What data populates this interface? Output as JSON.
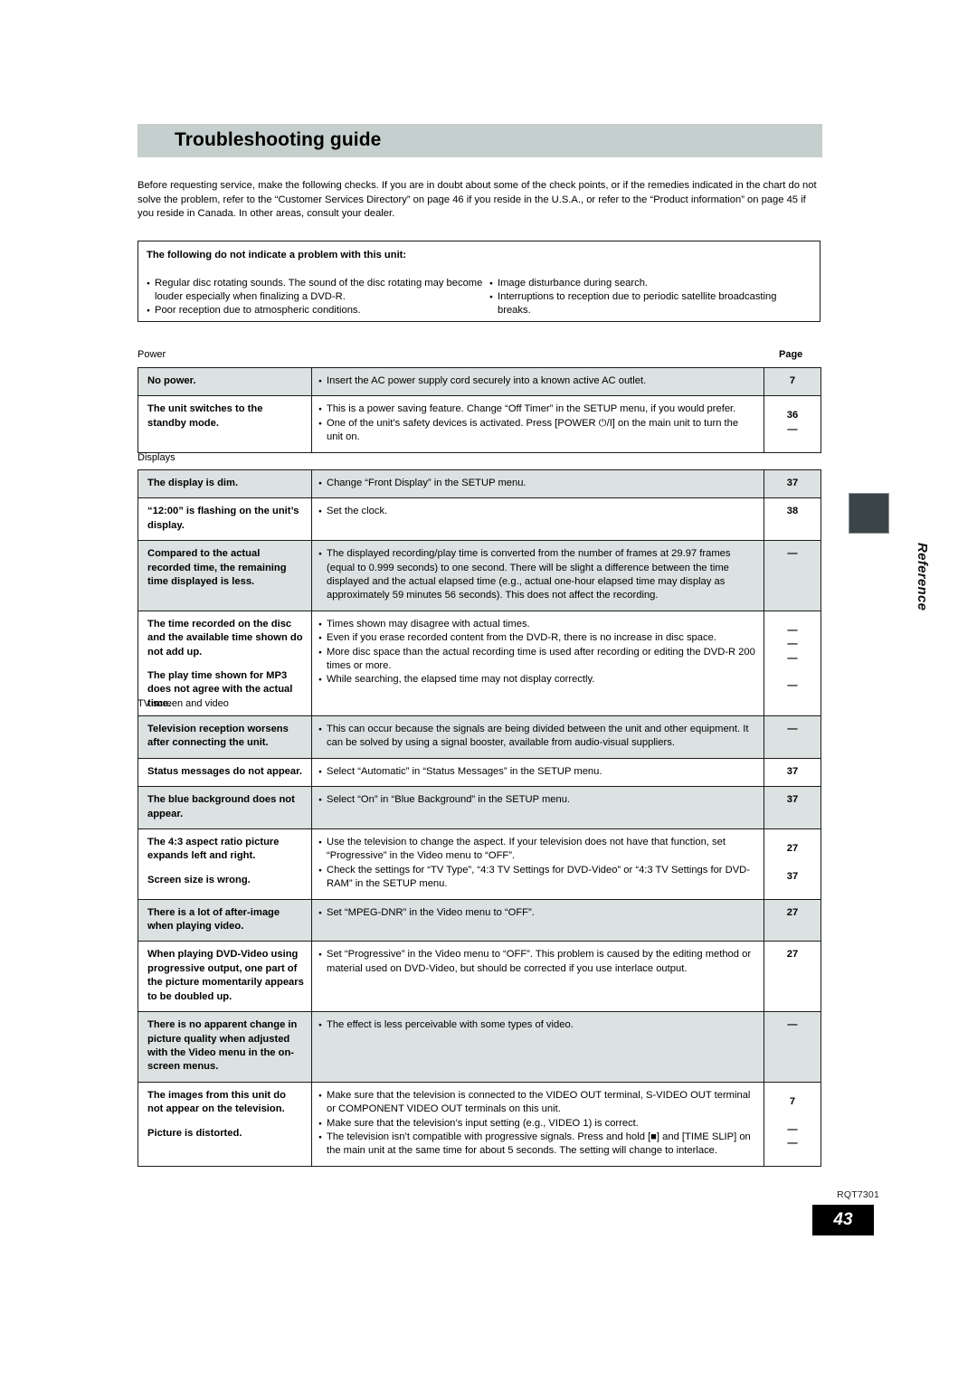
{
  "document": {
    "title": "Troubleshooting guide",
    "intro": "Before requesting service, make the following checks. If you are in doubt about some of the check points, or if the remedies indicated in the chart do not solve the problem, refer to the “Customer Services Directory” on page 46 if you reside in the U.S.A., or refer to the “Product information” on page 45 if you reside in Canada. In other areas, consult your dealer.",
    "side_tab": "Reference",
    "footer_code": "RQT7301",
    "page_number": "43"
  },
  "notebox": {
    "heading": "The following do not indicate a problem with this unit:",
    "left_items": [
      "Regular disc rotating sounds. The sound of the disc rotating may become louder especially when finalizing a DVD-R.",
      "Poor reception due to atmospheric conditions."
    ],
    "right_items": [
      "Image disturbance during search.",
      "Interruptions to reception due to periodic satellite broadcasting breaks."
    ]
  },
  "page_column_label": "Page",
  "sections": [
    {
      "label": "Power",
      "rows": [
        {
          "symptom": [
            "No power."
          ],
          "remedies": [
            "Insert the AC power supply cord securely into a known active AC outlet."
          ],
          "pages": [
            "7"
          ]
        },
        {
          "symptom": [
            "The unit switches to the standby mode."
          ],
          "remedies": [
            "This is a power saving feature. Change “Off Timer” in the SETUP menu, if you would prefer.",
            "One of the unit’s safety devices is activated. Press [POWER ⏻/I] on the main unit to turn the unit on."
          ],
          "pages": [
            "36",
            "—"
          ]
        }
      ]
    },
    {
      "label": "Displays",
      "rows": [
        {
          "symptom": [
            "The display is dim."
          ],
          "remedies": [
            "Change “Front Display” in the SETUP menu."
          ],
          "pages": [
            "37"
          ]
        },
        {
          "symptom": [
            "“12:00” is flashing on the unit’s display."
          ],
          "remedies": [
            "Set the clock."
          ],
          "pages": [
            "38"
          ]
        },
        {
          "symptom": [
            "Compared to the actual recorded time, the remaining time displayed is less."
          ],
          "remedies": [
            "The displayed recording/play time is converted from the number of frames at 29.97 frames (equal to 0.999 seconds) to one second. There will be slight a difference between the time displayed and the actual elapsed time (e.g., actual one-hour elapsed time may display as approximately 59 minutes 56 seconds). This does not affect the recording."
          ],
          "pages": [
            "—"
          ]
        },
        {
          "symptom": [
            "The time recorded on the disc and the available time shown do not add up.",
            "The play time shown for MP3 does not agree with the actual time."
          ],
          "remedies": [
            "Times shown may disagree with actual times.",
            "Even if you erase recorded content from the DVD-R, there is no increase in disc space.",
            "More disc space than the actual recording time is used after recording or editing the DVD-R 200 times or more.",
            "While searching, the elapsed time may not display correctly."
          ],
          "pages": [
            "—",
            "—",
            "—",
            "—"
          ]
        }
      ]
    },
    {
      "label": "TV screen and video",
      "rows": [
        {
          "symptom": [
            "Television reception worsens after connecting the unit."
          ],
          "remedies": [
            "This can occur because the signals are being divided between the unit and other equipment. It can be solved by using a signal booster, available from audio-visual suppliers."
          ],
          "pages": [
            "—"
          ]
        },
        {
          "symptom": [
            "Status messages do not appear."
          ],
          "remedies": [
            "Select “Automatic” in “Status Messages” in the SETUP menu."
          ],
          "pages": [
            "37"
          ]
        },
        {
          "symptom": [
            "The blue background does not appear."
          ],
          "remedies": [
            "Select “On” in “Blue Background” in the SETUP menu."
          ],
          "pages": [
            "37"
          ]
        },
        {
          "symptom": [
            "The 4:3 aspect ratio picture expands left and right.",
            "Screen size is wrong."
          ],
          "remedies": [
            "Use the television to change the aspect. If your television does not have that function, set “Progressive” in the Video menu to “OFF”.",
            "Check the settings for “TV Type”, “4:3 TV Settings for DVD-Video” or “4:3 TV Settings for DVD-RAM” in the SETUP menu."
          ],
          "pages": [
            "27",
            "37"
          ]
        },
        {
          "symptom": [
            "There is a lot of after-image when playing video."
          ],
          "remedies": [
            "Set “MPEG-DNR” in the Video menu to “OFF”."
          ],
          "pages": [
            "27"
          ]
        },
        {
          "symptom": [
            "When playing DVD-Video using progressive output, one part of the picture momentarily appears to be doubled up."
          ],
          "remedies": [
            "Set “Progressive” in the Video menu to “OFF”. This problem is caused by the editing method or material used on DVD-Video, but should be corrected if you use interlace output."
          ],
          "pages": [
            "27"
          ]
        },
        {
          "symptom": [
            "There is no apparent change in picture quality when adjusted with the Video menu in the on-screen menus."
          ],
          "remedies": [
            "The effect is less perceivable with some types of video."
          ],
          "pages": [
            "—"
          ]
        },
        {
          "symptom": [
            "The images from this unit do not appear on the television.",
            "Picture is distorted."
          ],
          "remedies": [
            "Make sure that the television is connected to the VIDEO OUT terminal, S-VIDEO OUT terminal or COMPONENT VIDEO OUT terminals on this unit.",
            "Make sure that the television’s input setting (e.g., VIDEO 1) is correct.",
            "The television isn’t compatible with progressive signals. Press and hold [■] and [TIME SLIP] on the main unit at the same time for about 5 seconds. The setting will change to interlace."
          ],
          "pages": [
            "7",
            "—",
            "—"
          ]
        }
      ]
    }
  ]
}
